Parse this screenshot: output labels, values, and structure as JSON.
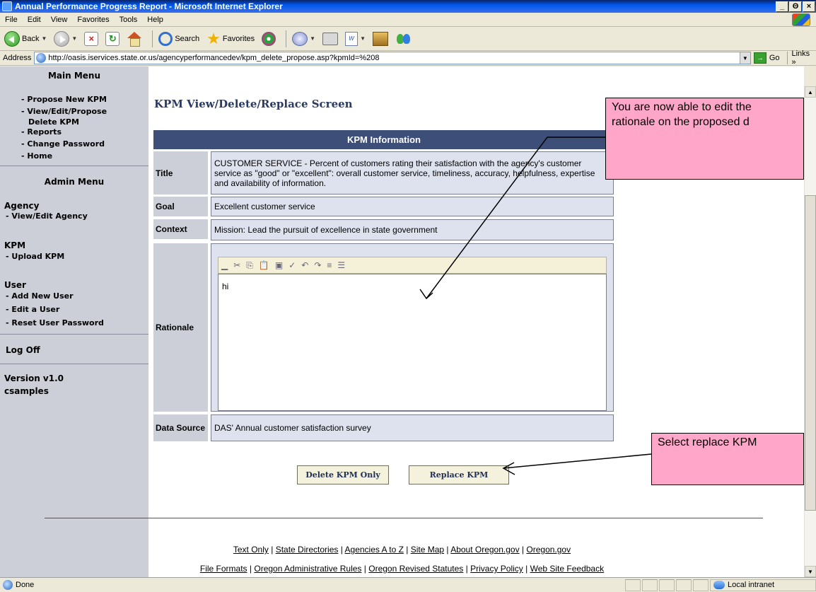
{
  "window": {
    "title": "Annual Performance Progress Report - Microsoft Internet Explorer",
    "minimize": "_",
    "maximize": "Θ",
    "close": "×"
  },
  "menubar": {
    "items": [
      "File",
      "Edit",
      "View",
      "Favorites",
      "Tools",
      "Help"
    ]
  },
  "toolbar": {
    "back_label": "Back",
    "search_label": "Search",
    "favorites_label": "Favorites"
  },
  "addressbar": {
    "label": "Address",
    "url": "http://oasis.iservices.state.or.us/agencyperformancedev/kpm_delete_propose.asp?kpmId=%208",
    "go_label": "Go",
    "links_label": "Links »"
  },
  "sidebar": {
    "main_menu_title": "Main Menu",
    "main_items": [
      "- Propose New KPM",
      "- View/Edit/Propose",
      "Delete KPM",
      "- Reports",
      "- Change Password",
      "- Home"
    ],
    "admin_menu_title": "Admin Menu",
    "agency_head": "Agency",
    "agency_items": [
      "- View/Edit Agency"
    ],
    "kpm_head": "KPM",
    "kpm_items": [
      "- Upload KPM"
    ],
    "user_head": "User",
    "user_items": [
      "- Add New User",
      "- Edit a User",
      "- Reset User Password"
    ],
    "logoff": "Log Off",
    "version": "Version v1.0",
    "username": "csamples"
  },
  "main": {
    "heading": "KPM View/Delete/Replace Screen",
    "table_header": "KPM Information",
    "rows": {
      "title_label": "Title",
      "title_value": "CUSTOMER SERVICE - Percent of customers rating their satisfaction with the agency's customer service as \"good\" or \"excellent\": overall customer service, timeliness, accuracy, helpfulness, expertise and availability of information.",
      "goal_label": "Goal",
      "goal_value": "Excellent customer service",
      "context_label": "Context",
      "context_value": "Mission: Lead the pursuit of excellence in state government",
      "rationale_label": "Rationale",
      "rationale_value": "hi",
      "datasource_label": "Data Source",
      "datasource_value": "DAS' Annual customer satisfaction survey"
    },
    "buttons": {
      "delete_label": "Delete KPM Only",
      "replace_label": "Replace KPM"
    }
  },
  "footer": {
    "line1": [
      "Text Only",
      "State Directories",
      "Agencies A to Z",
      "Site Map",
      "About Oregon.gov",
      "Oregon.gov"
    ],
    "line2": [
      "File Formats",
      "Oregon Administrative Rules",
      "Oregon Revised Statutes",
      "Privacy Policy",
      "Web Site Feedback"
    ],
    "separator": " | "
  },
  "annotations": {
    "callout1_line1": "You are now able to edit the",
    "callout1_line2": "rationale on the proposed d",
    "callout2": "Select replace KPM"
  },
  "statusbar": {
    "status": "Done",
    "zone": "Local intranet"
  }
}
